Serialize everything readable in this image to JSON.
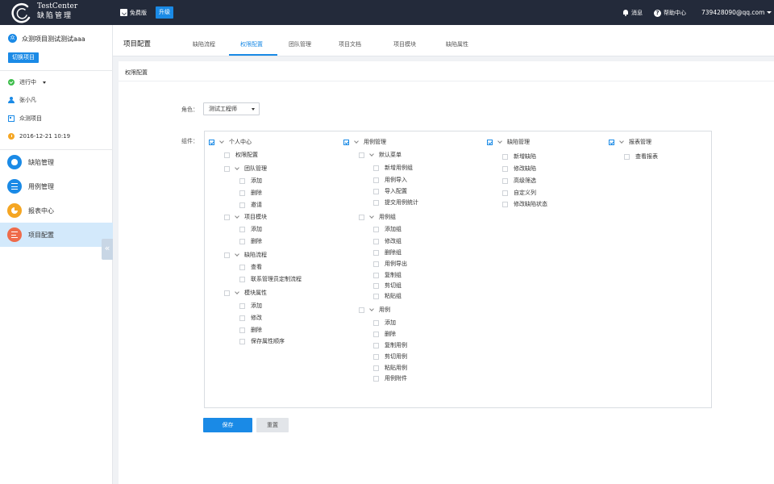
{
  "topbar": {
    "brand_en": "TestCenter",
    "brand_cn": "缺陷管理",
    "edition": "免费版",
    "upgrade": "升级",
    "messages": "消息",
    "help": "帮助中心",
    "user_email": "739428090@qq.com"
  },
  "sidebar": {
    "project_icon_text": "众",
    "project_name": "众测项目测试测试aaa",
    "switch_project": "切换项目",
    "status": "进行中",
    "owner": "张小凡",
    "project_type": "众测项目",
    "date": "2016-12-21  10:19",
    "nav": [
      "缺陷管理",
      "用例管理",
      "报表中心",
      "项目配置"
    ],
    "collapse_glyph": "«"
  },
  "header": {
    "title": "项目配置",
    "tabs": [
      "缺陷流程",
      "权限配置",
      "团队管理",
      "项目文档",
      "项目模块",
      "缺陷属性"
    ],
    "active_tab": "权限配置"
  },
  "panel": {
    "title": "权限配置",
    "role_label": "角色：",
    "role_value": "测试工程师",
    "component_label": "组件："
  },
  "permissions": {
    "col1": [
      "个人中心",
      "权限配置",
      "团队管理",
      "添加",
      "删除",
      "邀请",
      "项目模块",
      "添加",
      "删除",
      "缺陷流程",
      "查看",
      "联系管理员定制流程",
      "模块属性",
      "添加",
      "修改",
      "删除",
      "保存属性顺序"
    ],
    "col2": [
      "用例管理",
      "默认菜单",
      "新增用例组",
      "用例导入",
      "导入配置",
      "提交用例统计",
      "用例组",
      "添加组",
      "修改组",
      "删除组",
      "用例导出",
      "复制组",
      "剪切组",
      "粘贴组",
      "用例",
      "添加",
      "删除",
      "复制用例",
      "剪切用例",
      "粘贴用例",
      "用例附件"
    ],
    "col3": [
      "缺陷管理",
      "新增缺陷",
      "修改缺陷",
      "高级筛选",
      "自定义列",
      "修改缺陷状态"
    ],
    "col4": [
      "报表管理",
      "查看报表"
    ]
  },
  "buttons": {
    "save": "保存",
    "reset": "重置"
  }
}
